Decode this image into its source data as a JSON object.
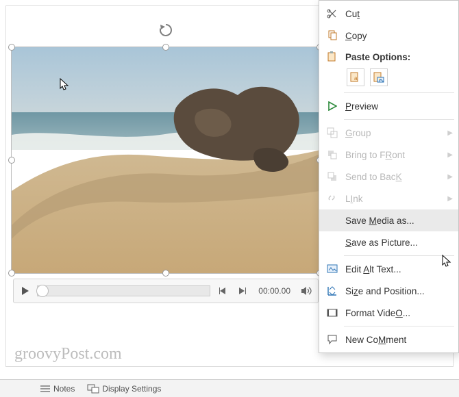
{
  "context_menu": {
    "cut": "Cut",
    "copy": "Copy",
    "paste_heading": "Paste Options:",
    "preview": "Preview",
    "group": "Group",
    "bring_front": "Bring to Front",
    "send_back": "Send to Back",
    "link": "Link",
    "save_media": "Save Media as...",
    "save_picture": "Save as Picture...",
    "edit_alt": "Edit Alt Text...",
    "size_pos": "Size and Position...",
    "format_video": "Format Video...",
    "new_comment": "New Comment"
  },
  "playback": {
    "time": "00:00.00"
  },
  "status": {
    "notes": "Notes",
    "display_settings": "Display Settings"
  },
  "watermark": "groovyPost.com",
  "accelerators": {
    "cut": "t",
    "copy": "C",
    "preview": "P",
    "group": "G",
    "bring_front": "R",
    "send_back": "K",
    "link": "I",
    "save_media": "M",
    "save_picture": "S",
    "edit_alt": "A",
    "size_pos": "z",
    "format_video": "O",
    "new_comment": "M"
  }
}
